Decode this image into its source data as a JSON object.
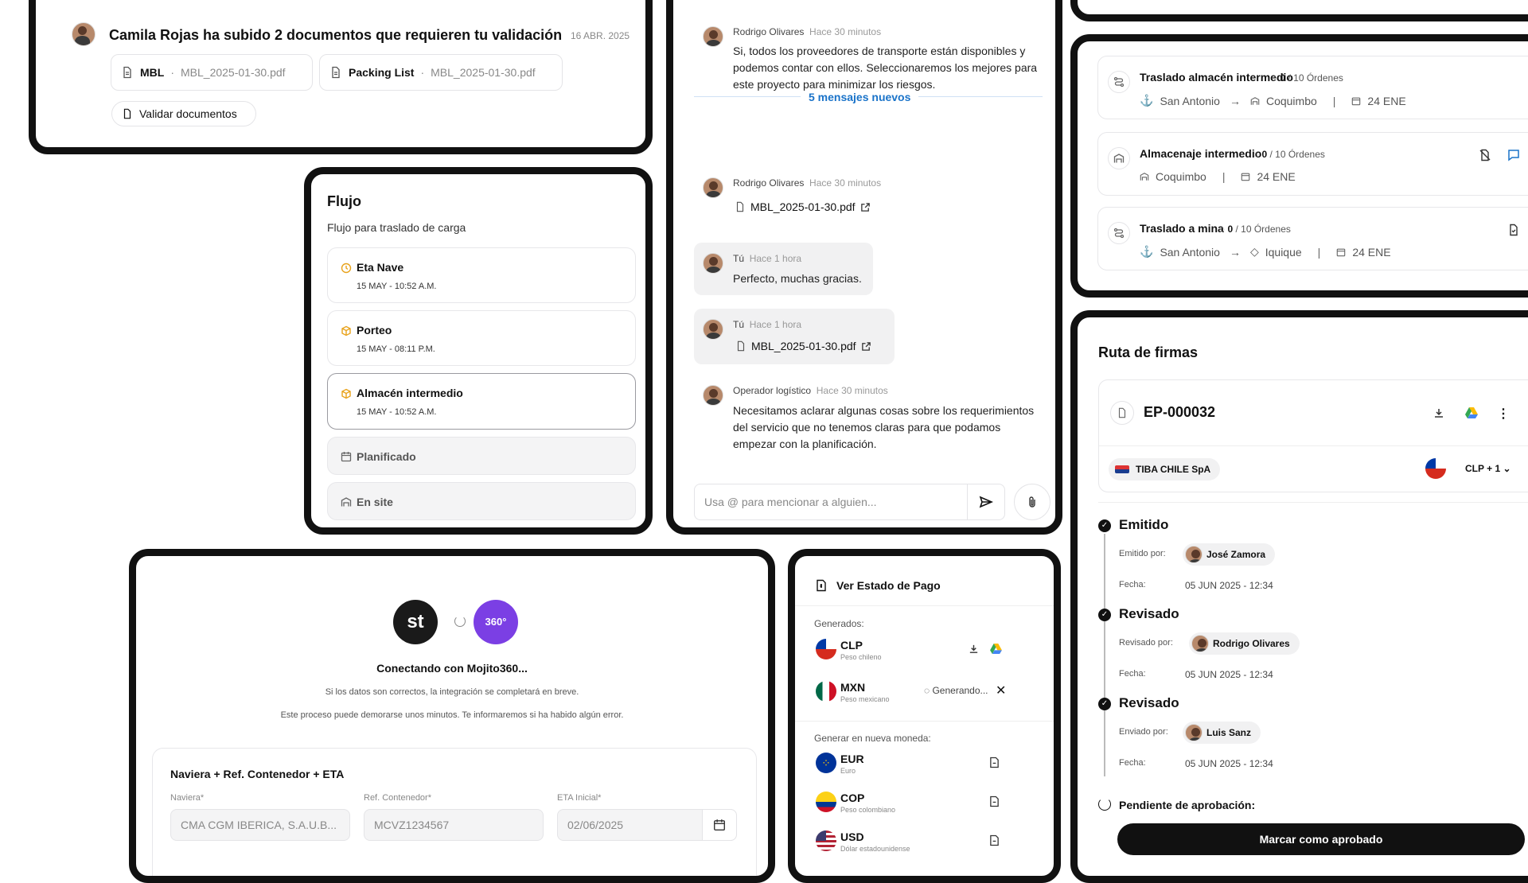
{
  "notification": {
    "text": "Camila Rojas ha subido 2 documentos que requieren tu validación",
    "date": "16 ABR. 2025",
    "docs": [
      {
        "type": "MBL",
        "file": "MBL_2025-01-30.pdf"
      },
      {
        "type": "Packing List",
        "file": "MBL_2025-01-30.pdf"
      }
    ],
    "separator": "·",
    "validate_label": "Validar documentos"
  },
  "flow": {
    "title": "Flujo",
    "subtitle": "Flujo para traslado de carga",
    "steps": [
      {
        "name": "Eta Nave",
        "date": "15 MAY - 10:52 A.M.",
        "icon": "clock-icon"
      },
      {
        "name": "Porteo",
        "date": "15 MAY - 08:11 P.M.",
        "icon": "box-icon"
      },
      {
        "name": "Almacén intermedio",
        "date": "15 MAY - 10:52 A.M.",
        "icon": "box-icon"
      },
      {
        "name": "Planificado",
        "icon": "calendar-icon"
      },
      {
        "name": "En site",
        "icon": "warehouse-icon"
      }
    ]
  },
  "chat": {
    "messages": [
      {
        "author": "Rodrigo Olivares",
        "time": "Hace 30 minutos",
        "text": "Si, todos los proveedores de transporte están disponibles y podemos contar con ellos. Seleccionaremos los mejores para este proyecto para minimizar los riesgos."
      },
      {
        "author": "Rodrigo Olivares",
        "time": "Hace 30 minutos",
        "file": "MBL_2025-01-30.pdf"
      },
      {
        "author": "Tú",
        "time": "Hace 1 hora",
        "text": "Perfecto, muchas gracias."
      },
      {
        "author": "Tú",
        "time": "Hace 1 hora",
        "file": "MBL_2025-01-30.pdf"
      },
      {
        "author": "Operador logístico",
        "time": "Hace 30 minutos",
        "text": "Necesitamos aclarar algunas cosas sobre los requerimientos del servicio que no tenemos claras para que podamos empezar con la planificación."
      }
    ],
    "divider": "5 mensajes nuevos",
    "input_placeholder": "Usa @ para mencionar a alguien..."
  },
  "orders": [
    {
      "title": "Traslado almacén intermedio",
      "progress": "0",
      "total": "/ 10 Órdenes",
      "from": "San Antonio",
      "to": "Coquimbo",
      "date": "24 ENE"
    },
    {
      "title": "Almacenaje intermedio",
      "progress": "0",
      "total": "/ 10 Órdenes",
      "from": "Coquimbo",
      "date": "24 ENE"
    },
    {
      "title": "Traslado a mina",
      "progress": "0",
      "total": "/ 10 Órdenes",
      "from": "San Antonio",
      "to": "Iquique",
      "date": "24 ENE"
    }
  ],
  "signatures": {
    "title": "Ruta de firmas",
    "doc_id": "EP-000032",
    "company": "TIBA CHILE SpA",
    "currency": "CLP + 1",
    "steps": [
      {
        "status": "Emitido",
        "by_label": "Emitido por:",
        "person": "José Zamora",
        "date_label": "Fecha:",
        "date": "05 JUN 2025 - 12:34"
      },
      {
        "status": "Revisado",
        "by_label": "Revisado por:",
        "person": "Rodrigo Olivares",
        "date_label": "Fecha:",
        "date": "05 JUN 2025 - 12:34"
      },
      {
        "status": "Revisado",
        "by_label": "Enviado por:",
        "person": "Luis Sanz",
        "date_label": "Fecha:",
        "date": "05 JUN 2025 - 12:34"
      }
    ],
    "pending": "Pendiente de aprobación:",
    "approve_label": "Marcar como aprobado"
  },
  "integration": {
    "logo_left": "st",
    "logo_right": "360°",
    "title": "Conectando con Mojito360...",
    "line1": "Si los datos son correctos, la integración se completará en breve.",
    "line2": "Este proceso puede demorarse unos minutos. Te informaremos si ha habido algún error.",
    "form_title": "Naviera + Ref. Contenedor + ETA",
    "fields": [
      {
        "label": "Naviera*",
        "value": "CMA CGM IBERICA, S.A.U.B..."
      },
      {
        "label": "Ref. Contenedor*",
        "value": "MCVZ1234567"
      },
      {
        "label": "ETA Inicial*",
        "value": "02/06/2025"
      }
    ]
  },
  "payment": {
    "title": "Ver Estado de Pago",
    "generated_label": "Generados:",
    "generated": [
      {
        "code": "CLP",
        "name": "Peso chileno"
      },
      {
        "code": "MXN",
        "name": "Peso mexicano",
        "status": "Generando..."
      }
    ],
    "new_label": "Generar en nueva moneda:",
    "new": [
      {
        "code": "EUR",
        "name": "Euro"
      },
      {
        "code": "COP",
        "name": "Peso colombiano"
      },
      {
        "code": "USD",
        "name": "Dólar estadounidense"
      }
    ]
  },
  "colors": {
    "accent": "#1a73c9",
    "brand_purple": "#7b3fe4",
    "dark": "#111111",
    "amber": "#e8a21b"
  }
}
